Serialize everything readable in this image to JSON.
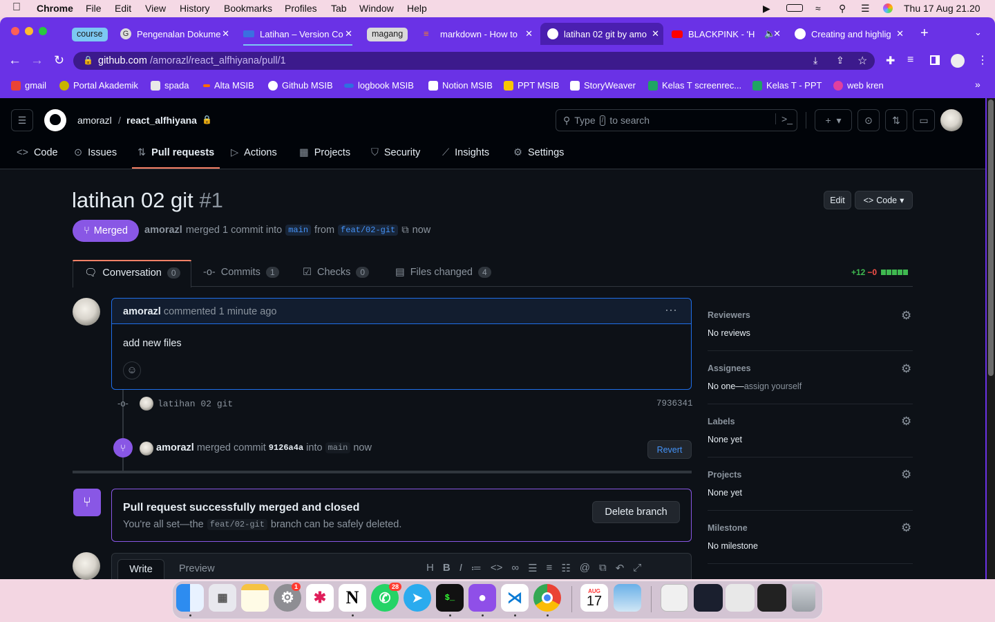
{
  "menubar": {
    "app": "Chrome",
    "items": [
      "File",
      "Edit",
      "View",
      "History",
      "Bookmarks",
      "Profiles",
      "Tab",
      "Window",
      "Help"
    ],
    "clock": "Thu 17 Aug  21.20"
  },
  "tabs": [
    {
      "group": "course",
      "label": "Pengenalan Dokume"
    },
    {
      "label": "Latihan – Version Co"
    },
    {
      "group": "magang",
      "label": "markdown - How to"
    },
    {
      "label": "latihan 02 git by amo",
      "active": true
    },
    {
      "label": "BLACKPINK - 'H"
    },
    {
      "label": "Creating and highlig"
    }
  ],
  "omnibox": {
    "domain": "github.com",
    "path": "/amorazl/react_alfhiyana/pull/1"
  },
  "bookmarks": [
    {
      "label": "gmail",
      "color": "#ea4335"
    },
    {
      "label": "Portal Akademik",
      "color": "#c9b400"
    },
    {
      "label": "spada",
      "color": "#e8e8e8"
    },
    {
      "label": "Alta MSIB",
      "color": "#ff6b00"
    },
    {
      "label": "Github MSIB",
      "color": "#ffffff"
    },
    {
      "label": "logbook MSIB",
      "color": "#2f6fe0"
    },
    {
      "label": "Notion MSIB",
      "color": "#ffffff"
    },
    {
      "label": "PPT MSIB",
      "color": "#f7c600"
    },
    {
      "label": "StoryWeaver",
      "color": "#ffffff"
    },
    {
      "label": "Kelas T screenrec...",
      "color": "#1fa463"
    },
    {
      "label": "Kelas T - PPT",
      "color": "#1fa463"
    },
    {
      "label": "web kren",
      "color": "#e040a0"
    }
  ],
  "repo": {
    "owner": "amorazl",
    "name": "react_alfhiyana"
  },
  "search_placeholder_prefix": "Type",
  "search_key": "/",
  "search_placeholder_suffix": "to search",
  "repo_nav": [
    "Code",
    "Issues",
    "Pull requests",
    "Actions",
    "Projects",
    "Security",
    "Insights",
    "Settings"
  ],
  "pr": {
    "title": "latihan 02 git",
    "number": "#1",
    "state": "Merged",
    "author": "amorazl",
    "summary_mid": "merged 1 commit into",
    "base": "main",
    "from_word": "from",
    "head": "feat/02-git",
    "time": "now",
    "edit_label": "Edit",
    "code_label": "Code"
  },
  "pr_tabs": [
    {
      "label": "Conversation",
      "count": "0"
    },
    {
      "label": "Commits",
      "count": "1"
    },
    {
      "label": "Checks",
      "count": "0"
    },
    {
      "label": "Files changed",
      "count": "4"
    }
  ],
  "diffstat": {
    "add": "+12",
    "del": "−0"
  },
  "comment": {
    "author": "amorazl",
    "meta": "commented 1 minute ago",
    "body": "add new files"
  },
  "commit_item": {
    "message": "latihan 02 git",
    "sha": "7936341"
  },
  "merge_event": {
    "author": "amorazl",
    "text1": "merged commit",
    "sha": "9126a4a",
    "text2": "into",
    "branch": "main",
    "time": "now",
    "revert": "Revert"
  },
  "merged_box": {
    "title": "Pull request successfully merged and closed",
    "text1": "You're all set—the",
    "branch": "feat/02-git",
    "text2": "branch can be safely deleted.",
    "button": "Delete branch"
  },
  "composer": {
    "write": "Write",
    "preview": "Preview"
  },
  "sidebar": [
    {
      "heading": "Reviewers",
      "value": "No reviews"
    },
    {
      "heading": "Assignees",
      "value": "No one—",
      "link": "assign yourself"
    },
    {
      "heading": "Labels",
      "value": "None yet"
    },
    {
      "heading": "Projects",
      "value": "None yet"
    },
    {
      "heading": "Milestone",
      "value": "No milestone"
    }
  ],
  "dock_badges": {
    "settings": "1",
    "whatsapp": "28"
  },
  "calendar": {
    "month": "AUG",
    "day": "17"
  },
  "colors": {
    "merged": "#8957e5",
    "accent": "#4493f8",
    "add": "#3fb950",
    "del": "#f85149",
    "chrome": "#6a32e6"
  }
}
